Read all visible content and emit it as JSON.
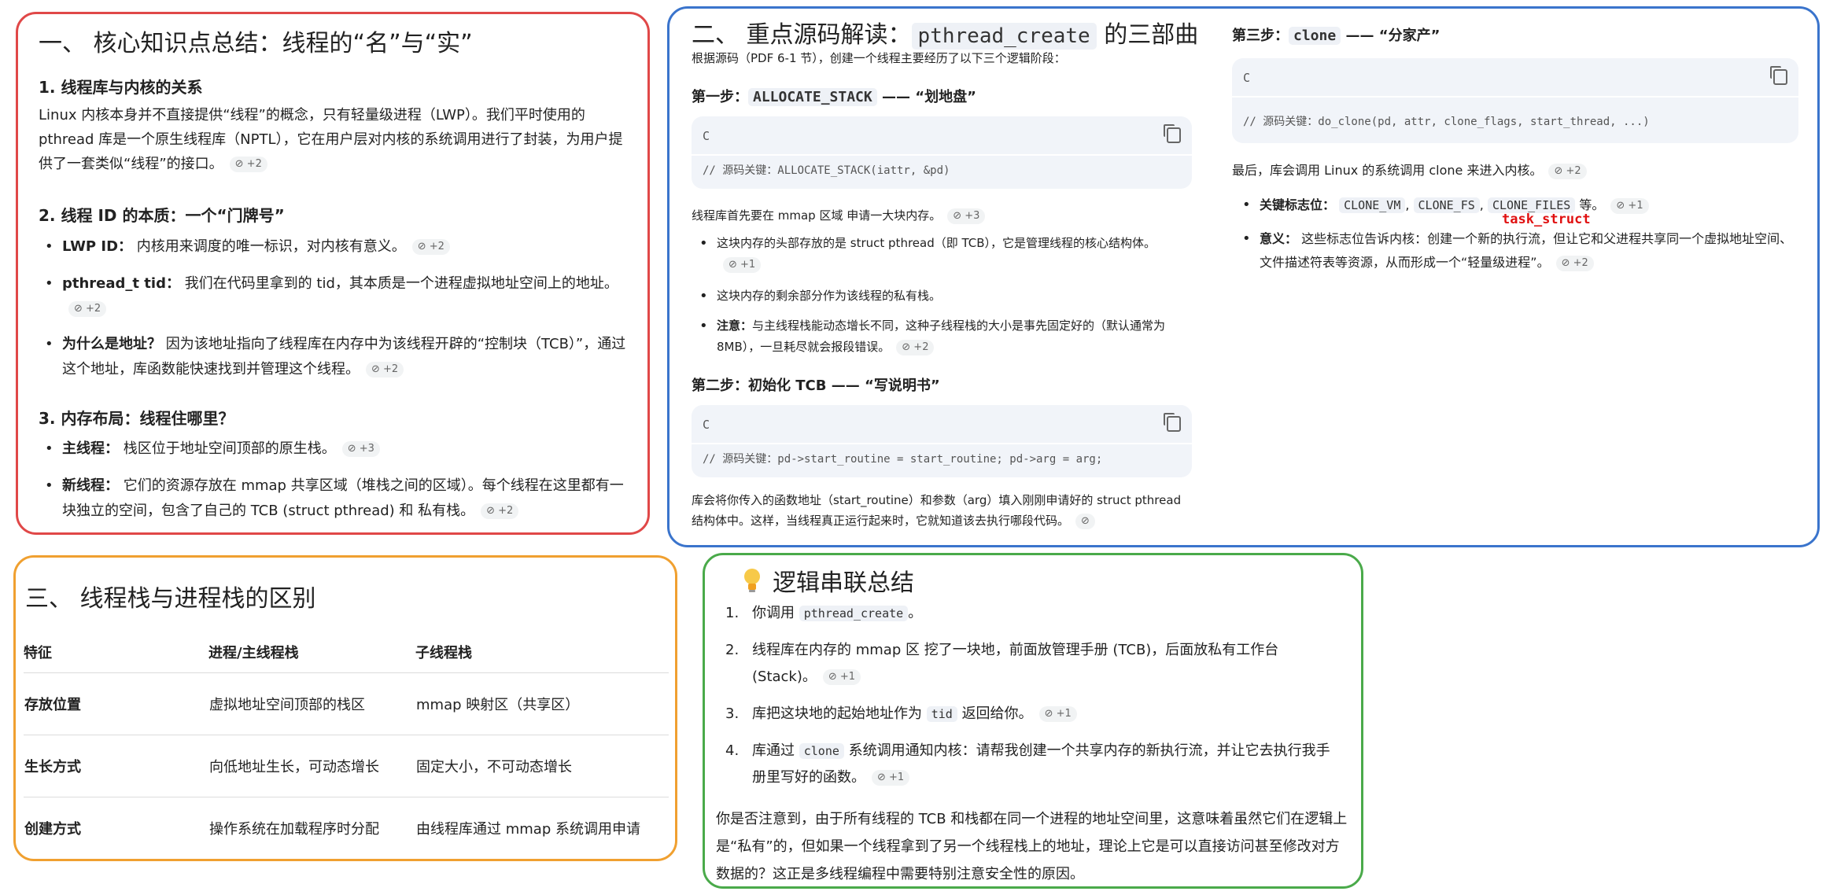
{
  "p1": {
    "title": "一、 核心知识点总结：线程的“名”与“实”",
    "s1_title": "1. 线程库与内核的关系",
    "s1_para": "Linux 内核本身并不直接提供“线程”的概念，只有轻量级进程（LWP）。我们平时使用的 pthread 库是一个原生线程库（NPTL），它在用户层对内核的系统调用进行了封装，为用户提供了一套类似“线程”的接口。",
    "s1_chip": "⊘ +2",
    "s2_title": "2. 线程 ID 的本质：一个“门牌号”",
    "s2_b1_strong": "LWP ID：",
    "s2_b1": "内核用来调度的唯一标识，对内核有意义。",
    "s2_b1_chip": "⊘ +2",
    "s2_b2_strong": "pthread_t tid：",
    "s2_b2": "我们在代码里拿到的 tid，其本质是一个进程虚拟地址空间上的地址。",
    "s2_b2_chip": "⊘ +2",
    "s2_b3_strong": "为什么是地址？",
    "s2_b3": "因为该地址指向了线程库在内存中为该线程开辟的“控制块（TCB）”，通过这个地址，库函数能快速找到并管理这个线程。",
    "s2_b3_chip": "⊘ +2",
    "s3_title": "3. 内存布局：线程住哪里？",
    "s3_b1_strong": "主线程：",
    "s3_b1": "栈区位于地址空间顶部的原生栈。",
    "s3_b1_chip": "⊘ +3",
    "s3_b2_strong": "新线程：",
    "s3_b2": "它们的资源存放在 mmap 共享区域（堆栈之间的区域）。每个线程在这里都有一块独立的空间，包含了自己的 TCB (struct pthread) 和 私有栈。",
    "s3_b2_chip": "⊘ +2"
  },
  "p2": {
    "title_pre": "二、 重点源码解读：",
    "title_code": "pthread_create",
    "title_post": "的三部曲",
    "intro": "根据源码（PDF 6-1 节），创建一个线程主要经历了以下三个逻辑阶段：",
    "step1_pre": "第一步：",
    "step1_code": "ALLOCATE_STACK",
    "step1_post": "—— “划地盘”",
    "code_lang": "C",
    "code1": "// 源码关键：ALLOCATE_STACK(iattr, &pd)",
    "after1": "线程库首先要在 mmap 区域 申请一大块内存。",
    "after1_chip": "⊘ +3",
    "b1": "这块内存的头部存放的是 struct pthread（即 TCB），它是管理线程的核心结构体。",
    "b1_chip": "⊘ +1",
    "b2": "这块内存的剩余部分作为该线程的私有栈。",
    "b3_strong": "注意：",
    "b3": "与主线程栈能动态增长不同，这种子线程栈的大小是事先固定好的（默认通常为 8MB），一旦耗尽就会报段错误。",
    "b3_chip": "⊘ +2",
    "step2": "第二步：初始化 TCB —— “写说明书”",
    "code2": "// 源码关键：pd->start_routine = start_routine; pd->arg = arg;",
    "after2": "库会将你传入的函数地址（start_routine）和参数（arg）填入刚刚申请好的 struct pthread 结构体中。这样，当线程真正运行起来时，它就知道该去执行哪段代码。",
    "after2_chip": "⊘",
    "step3_pre": "第三步：",
    "step3_code": "clone",
    "step3_post": "—— “分家产”",
    "code3": "// 源码关键：do_clone(pd, attr, clone_flags, start_thread, ...)",
    "final": "最后，库会调用 Linux 的系统调用 clone 来进入内核。",
    "final_chip": "⊘ +2",
    "fb1_strong": "关键标志位：",
    "fb1_c1": "CLONE_VM",
    "fb1_c2": "CLONE_FS",
    "fb1_c3": "CLONE_FILES",
    "fb1_post": "等。",
    "fb1_chip": "⊘ +1",
    "red_note": "task_struct",
    "fb2_strong": "意义：",
    "fb2": "这些标志位告诉内核：创建一个新的执行流，但让它和父进程共享同一个虚拟地址空间、文件描述符表等资源，从而形成一个“轻量级进程”。",
    "fb2_chip": "⊘ +2"
  },
  "p3": {
    "title": "三、 线程栈与进程栈的区别",
    "headers": [
      "特征",
      "进程/主线程栈",
      "子线程栈"
    ],
    "rows": [
      [
        "存放位置",
        "虚拟地址空间顶部的栈区",
        "mmap 映射区（共享区）"
      ],
      [
        "生长方式",
        "向低地址生长，可动态增长",
        "固定大小，不可动态增长"
      ],
      [
        "创建方式",
        "操作系统在加载程序时分配",
        "由线程库通过 mmap 系统调用申请"
      ]
    ]
  },
  "p4": {
    "title": "逻辑串联总结",
    "i1_pre": "你调用",
    "i1_code": "pthread_create",
    "i1_post": "。",
    "i2": "线程库在内存的 mmap 区 挖了一块地，前面放管理手册 (TCB)，后面放私有工作台 (Stack)。",
    "i2_chip": "⊘ +1",
    "i3_pre": "库把这块地的起始地址作为",
    "i3_code": "tid",
    "i3_post": "返回给你。",
    "i3_chip": "⊘ +1",
    "i4_pre": "库通过",
    "i4_code": "clone",
    "i4_post": "系统调用通知内核：请帮我创建一个共享内存的新执行流，并让它去执行我手册里写好的函数。",
    "i4_chip": "⊘ +1",
    "summary": "你是否注意到，由于所有线程的 TCB 和栈都在同一个进程的地址空间里，这意味着虽然它们在逻辑上是“私有”的，但如果一个线程拿到了另一个线程栈上的地址，理论上它是可以直接访问甚至修改对方数据的？这正是多线程编程中需要特别注意安全性的原因。"
  }
}
